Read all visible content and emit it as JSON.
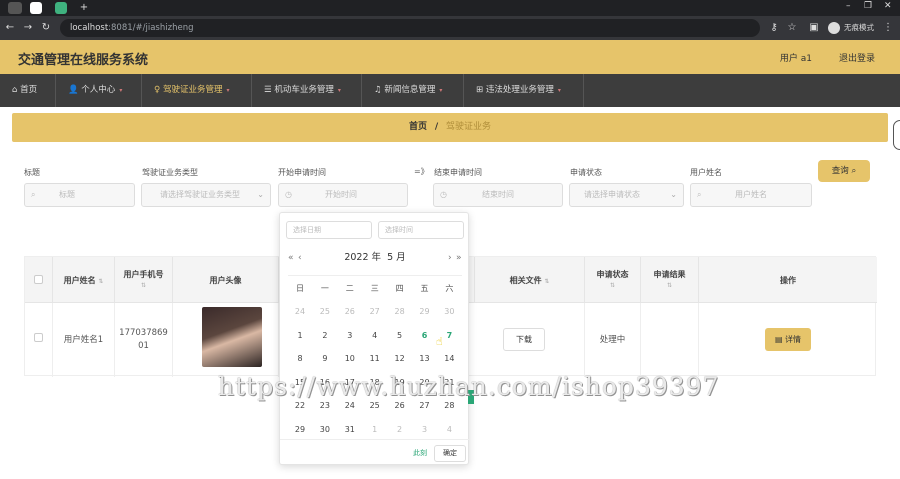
{
  "browser": {
    "url_host": "localhost",
    "url_path": ":8081/#/jiashizheng",
    "profile_label": "无痕模式"
  },
  "app": {
    "title": "交通管理在线服务系统",
    "user_label": "用户 a1",
    "logout_label": "退出登录"
  },
  "menu": [
    {
      "label": "首页",
      "icon": "home-icon"
    },
    {
      "label": "个人中心",
      "icon": "user-icon"
    },
    {
      "label": "驾驶证业务管理",
      "icon": "bulb-icon"
    },
    {
      "label": "机动车业务管理",
      "icon": "list-icon"
    },
    {
      "label": "新闻信息管理",
      "icon": "bell-icon"
    },
    {
      "label": "违法处理业务管理",
      "icon": "grid-icon"
    }
  ],
  "breadcrumb": {
    "home": "首页",
    "sep": "/",
    "current": "驾驶证业务"
  },
  "filters": {
    "title_label": "标题",
    "title_placeholder": "标题",
    "type_label": "驾驶证业务类型",
    "type_placeholder": "请选择驾驶证业务类型",
    "start_label": "开始申请时间",
    "start_placeholder": "开始时间",
    "end_label": "结束申请时间",
    "end_placeholder": "结束时间",
    "status_label": "申请状态",
    "status_placeholder": "请选择申请状态",
    "user_label": "用户姓名",
    "user_placeholder": "用户姓名",
    "query_button": "查询"
  },
  "table": {
    "headers": [
      "用户姓名",
      "用户手机号",
      "用户头像",
      "相关文件",
      "申请状态",
      "申请结果",
      "操作"
    ],
    "rows": [
      {
        "name": "用户姓名1",
        "phone_l1": "177037869",
        "phone_l2": "01",
        "file_btn": "下载",
        "status": "处理中",
        "result": "",
        "action": "详情"
      }
    ]
  },
  "picker": {
    "date_placeholder": "选择日期",
    "time_placeholder": "选择时间",
    "year": "2022 年",
    "month": "5 月",
    "weekdays": [
      "日",
      "一",
      "二",
      "三",
      "四",
      "五",
      "六"
    ],
    "now_label": "此刻",
    "ok_label": "确定"
  },
  "watermark": "https://www.huzhan.com/ishop39397",
  "colors": {
    "accent": "#e6c46a",
    "today": "#2aa676",
    "menu_bg": "#3d3d3d"
  }
}
